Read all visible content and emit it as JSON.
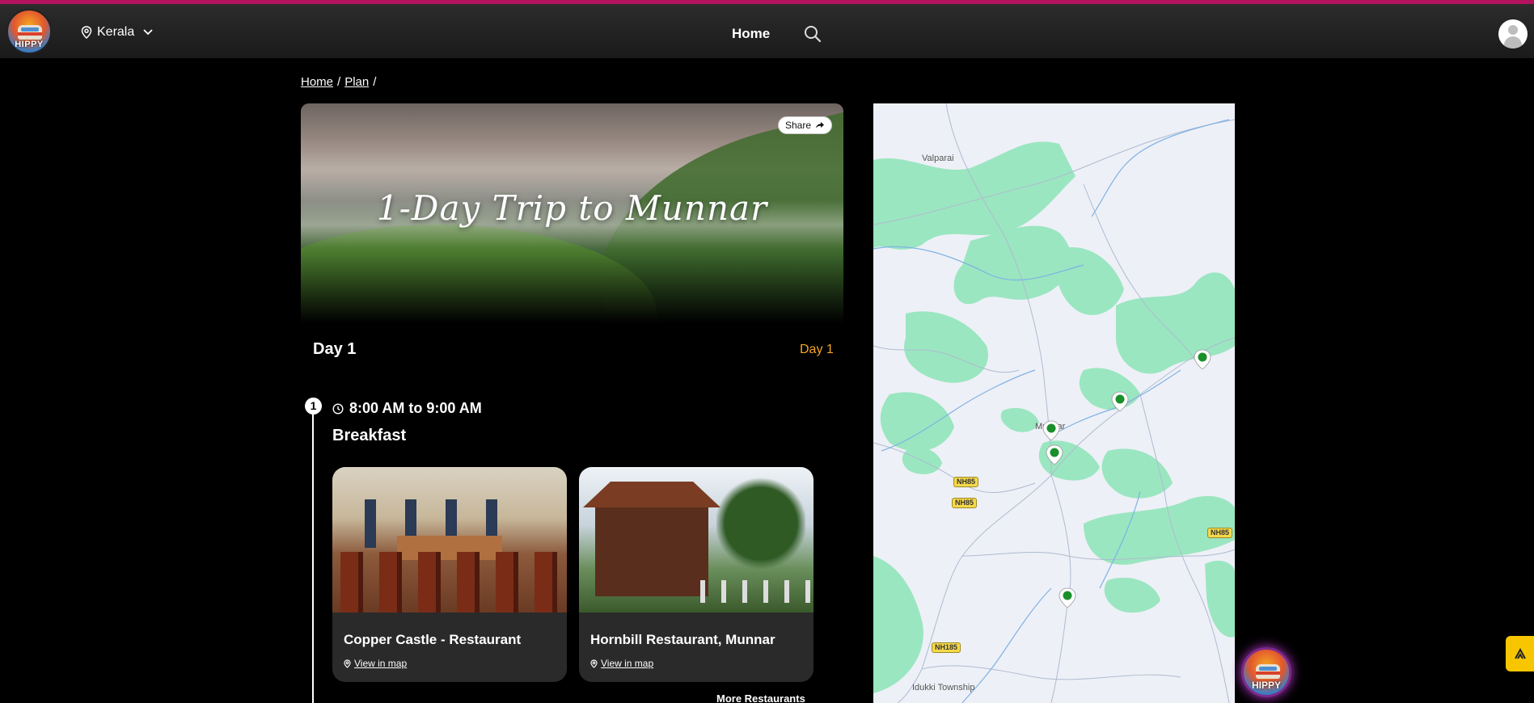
{
  "brand": {
    "logo_text": "HIPPY"
  },
  "header": {
    "location": "Kerala",
    "nav_home": "Home"
  },
  "breadcrumb": {
    "home": "Home",
    "sep1": "/",
    "plan": "Plan",
    "sep2": "/"
  },
  "hero": {
    "title": "1-Day Trip to Munnar",
    "share_label": "Share"
  },
  "day": {
    "heading": "Day 1",
    "tab_label": "Day 1"
  },
  "schedule": [
    {
      "step": "1",
      "time": "8:00 AM to 9:00 AM",
      "meal": "Breakfast",
      "places": [
        {
          "name": "Copper Castle - Restaurant",
          "link": "View in map"
        },
        {
          "name": "Hornbill Restaurant, Munnar",
          "link": "View in map"
        }
      ],
      "more_label": "More Restaurants"
    }
  ],
  "map": {
    "labels": [
      "Valparai",
      "Munnar",
      "Idukki Township"
    ],
    "highway_badges": [
      "NH85",
      "NH85",
      "NH85",
      "NH185"
    ]
  },
  "colors": {
    "accent_top_line": "#b3125d",
    "day_tab": "#f5a623",
    "scroll_top_button": "#f7c600",
    "map_forest": "#9ae6c0",
    "map_marker": "#1a8f2a"
  }
}
